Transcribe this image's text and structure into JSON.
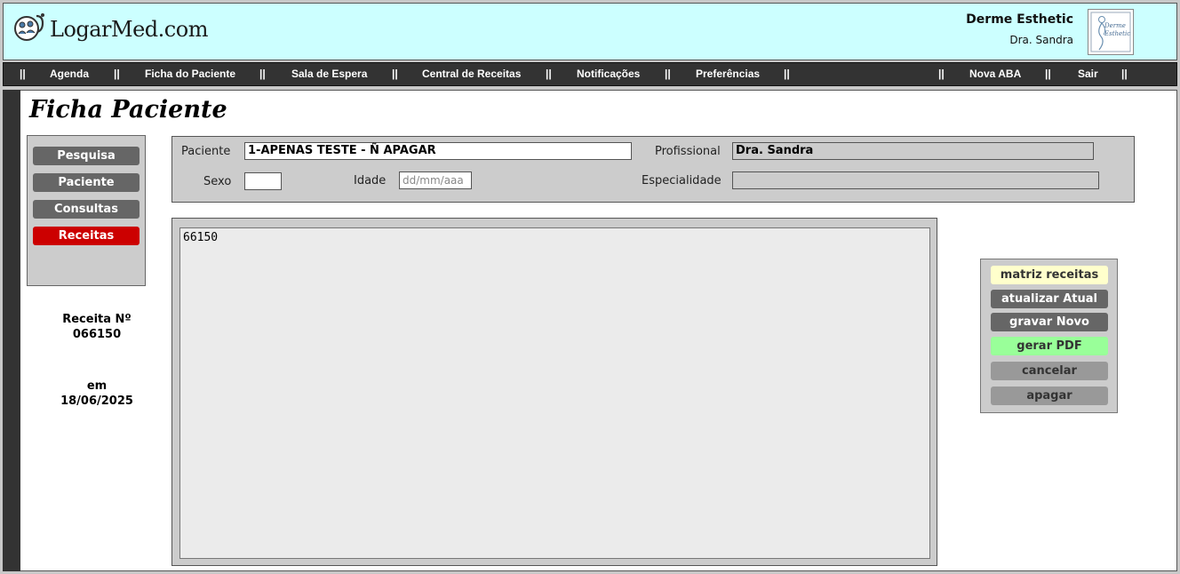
{
  "header": {
    "logo_text": "LogarMed.com",
    "clinic_name": "Derme Esthetic",
    "doctor_name": "Dra. Sandra",
    "clinic_logo_text": "Derme Esthetic"
  },
  "nav": {
    "separator": "||",
    "items": [
      "Agenda",
      "Ficha do Paciente",
      "Sala de Espera",
      "Central de Receitas",
      "Notificações",
      "Preferências"
    ],
    "right_items": [
      "Nova ABA",
      "Sair"
    ]
  },
  "page_title": "Ficha Paciente",
  "left_menu": {
    "items": [
      "Pesquisa",
      "Paciente",
      "Consultas",
      "Receitas"
    ],
    "active": "Receitas"
  },
  "recipe_info": {
    "number_label": "Receita Nº",
    "number": "066150",
    "date_label": "em",
    "date": "18/06/2025"
  },
  "patient_form": {
    "patient_label": "Paciente",
    "patient_value": "1-APENAS TESTE - Ñ APAGAR",
    "professional_label": "Profissional",
    "professional_value": "Dra. Sandra",
    "sex_label": "Sexo",
    "sex_value": "",
    "age_label": "Idade",
    "age_placeholder": "dd/mm/aaa",
    "specialty_label": "Especialidade",
    "specialty_value": ""
  },
  "recipe_text": "66150",
  "actions": [
    "matriz receitas",
    "atualizar Atual",
    "gravar Novo",
    "gerar PDF",
    "cancelar",
    "apagar"
  ],
  "colors": {
    "header_bg": "#ccffff",
    "nav_bg": "#333333",
    "active_menu": "#cc0000",
    "pdf_button": "#99ff99",
    "matrix_button": "#ffffcc"
  }
}
